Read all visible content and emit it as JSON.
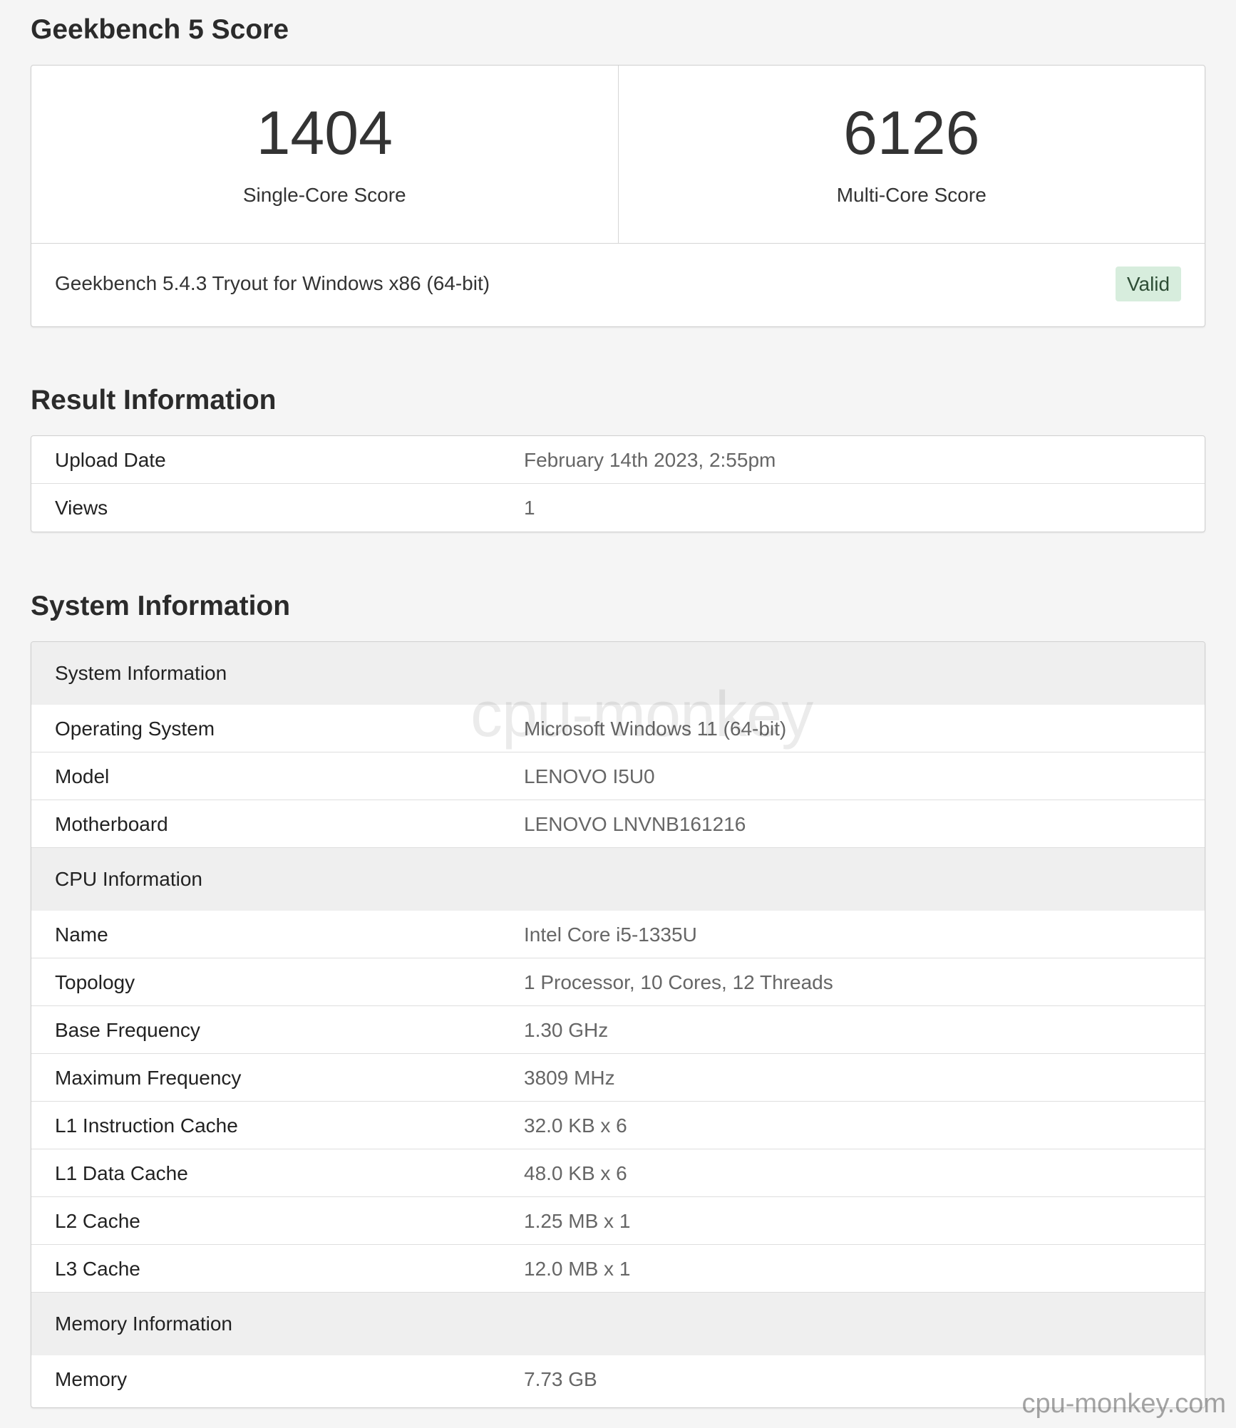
{
  "score_section": {
    "heading": "Geekbench 5 Score",
    "single_core": {
      "value": "1404",
      "label": "Single-Core Score"
    },
    "multi_core": {
      "value": "6126",
      "label": "Multi-Core Score"
    },
    "version": "Geekbench 5.4.3 Tryout for Windows x86 (64-bit)",
    "status_badge": "Valid",
    "status_color": "#d7eddd"
  },
  "result_section": {
    "heading": "Result Information",
    "rows": [
      {
        "key": "Upload Date",
        "value": "February 14th 2023, 2:55pm"
      },
      {
        "key": "Views",
        "value": "1"
      }
    ]
  },
  "system_section": {
    "heading": "System Information",
    "groups": [
      {
        "title": "System Information",
        "rows": [
          {
            "key": "Operating System",
            "value": "Microsoft Windows 11 (64-bit)"
          },
          {
            "key": "Model",
            "value": "LENOVO I5U0"
          },
          {
            "key": "Motherboard",
            "value": "LENOVO LNVNB161216"
          }
        ]
      },
      {
        "title": "CPU Information",
        "rows": [
          {
            "key": "Name",
            "value": "Intel Core i5-1335U"
          },
          {
            "key": "Topology",
            "value": "1 Processor, 10 Cores, 12 Threads"
          },
          {
            "key": "Base Frequency",
            "value": "1.30 GHz"
          },
          {
            "key": "Maximum Frequency",
            "value": "3809 MHz"
          },
          {
            "key": "L1 Instruction Cache",
            "value": "32.0 KB x 6"
          },
          {
            "key": "L1 Data Cache",
            "value": "48.0 KB x 6"
          },
          {
            "key": "L2 Cache",
            "value": "1.25 MB x 1"
          },
          {
            "key": "L3 Cache",
            "value": "12.0 MB x 1"
          }
        ]
      },
      {
        "title": "Memory Information",
        "rows": [
          {
            "key": "Memory",
            "value": "7.73 GB"
          }
        ]
      }
    ]
  },
  "watermark": {
    "center_text": "cpu-monkey",
    "corner_text": "cpu-monkey.com"
  }
}
